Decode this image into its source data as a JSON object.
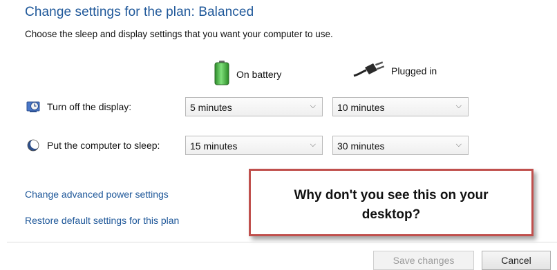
{
  "header": {
    "title": "Change settings for the plan: Balanced",
    "subtitle": "Choose the sleep and display settings that you want your computer to use."
  },
  "columns": {
    "battery": {
      "label": "On battery",
      "icon": "battery-icon"
    },
    "plugged": {
      "label": "Plugged in",
      "icon": "power-plug-icon"
    }
  },
  "rows": [
    {
      "label": "Turn off the display:",
      "icon": "display-clock-icon",
      "battery_value": "5 minutes",
      "plugged_value": "10 minutes"
    },
    {
      "label": "Put the computer to sleep:",
      "icon": "sleep-moon-icon",
      "battery_value": "15 minutes",
      "plugged_value": "30 minutes"
    }
  ],
  "links": {
    "advanced": "Change advanced power settings",
    "restore": "Restore default settings for this plan"
  },
  "buttons": {
    "save": "Save changes",
    "cancel": "Cancel"
  },
  "callout": {
    "line1": "Why don't you see this on your",
    "line2": "desktop?"
  },
  "colors": {
    "title": "#1e5799",
    "link": "#1e5799",
    "callout_border": "#c0504d",
    "battery": "#3aa335"
  }
}
